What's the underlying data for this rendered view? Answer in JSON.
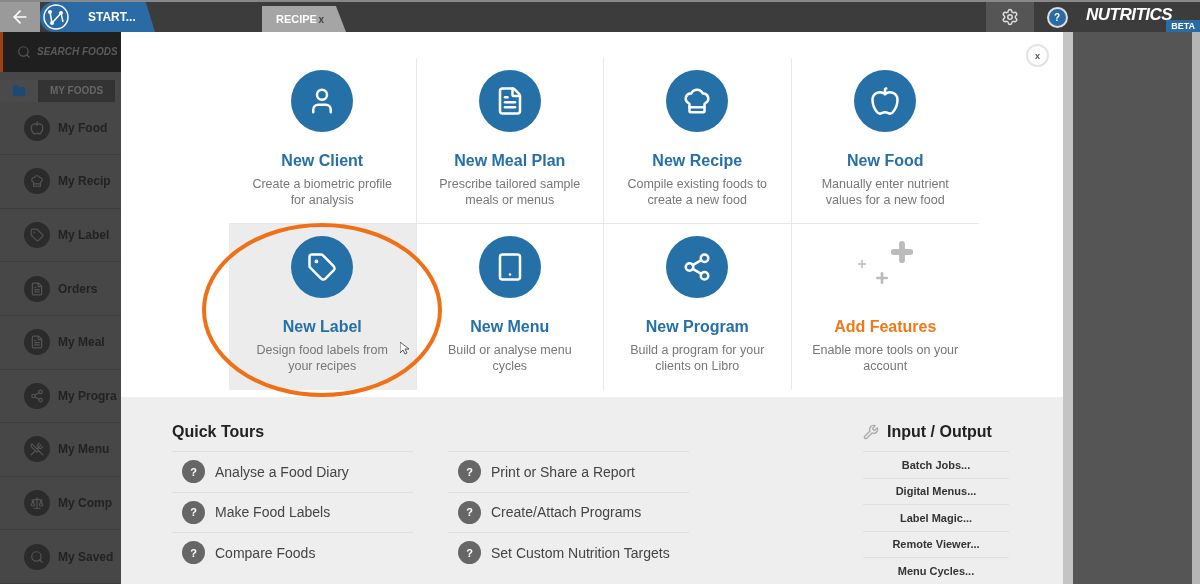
{
  "top_bar": {
    "home_tab": "START...",
    "tabs": [
      {
        "label": "RECIPE",
        "close": "x",
        "selected": true
      }
    ],
    "help": "?",
    "logo": "NUTRITICS",
    "logo_badge": "BETA"
  },
  "sidebar": {
    "search": {
      "placeholder": "SEARCH FOODS"
    },
    "tabs": [
      {
        "kind": "folder",
        "selected": true
      },
      {
        "kind": "text",
        "label": "MY FOODS",
        "selected": false
      }
    ],
    "items": [
      {
        "label": "My Food"
      },
      {
        "label": "My Recip"
      },
      {
        "label": "My Label"
      },
      {
        "label": "Orders"
      },
      {
        "label": "My Meal"
      },
      {
        "label": "My Progra"
      },
      {
        "label": "My Menu"
      },
      {
        "label": "My Comp"
      },
      {
        "label": "My Saved"
      }
    ]
  },
  "dialog": {
    "close": "x",
    "tiles": [
      {
        "kind": "action",
        "title": "New Client",
        "description": "Create a biometric profile for analysis",
        "selected": false
      },
      {
        "kind": "action",
        "title": "New Meal Plan",
        "description": "Prescribe tailored sample meals or menus",
        "selected": false
      },
      {
        "kind": "action",
        "title": "New Recipe",
        "description": "Compile existing foods to create a new food",
        "selected": false
      },
      {
        "kind": "action",
        "title": "New Food",
        "description": "Manually enter nutrient values for a new food",
        "selected": false
      },
      {
        "kind": "action",
        "title": "New Label",
        "description": "Design food labels from your recipes",
        "selected": true
      },
      {
        "kind": "action",
        "title": "New Menu",
        "description": "Build or analyse menu cycles",
        "selected": false
      },
      {
        "kind": "action",
        "title": "New Program",
        "description": "Build a program for your clients on Libro",
        "selected": false
      },
      {
        "kind": "addon",
        "title": "Add Features",
        "description": "Enable more tools on your account",
        "selected": false
      }
    ],
    "quick_tours": {
      "title": "Quick Tours",
      "columns": [
        [
          {
            "icon": "?",
            "label": "Analyse a Food Diary"
          },
          {
            "icon": "?",
            "label": "Make Food Labels"
          },
          {
            "icon": "?",
            "label": "Compare Foods"
          }
        ],
        [
          {
            "icon": "?",
            "label": "Print or Share a Report"
          },
          {
            "icon": "?",
            "label": "Create/Attach Programs"
          },
          {
            "icon": "?",
            "label": "Set Custom Nutrition Targets"
          }
        ]
      ]
    },
    "input_output": {
      "title": "Input / Output",
      "items": [
        "Batch Jobs...",
        "Digital Menus...",
        "Label Magic...",
        "Remote Viewer...",
        "Menu Cycles..."
      ]
    }
  }
}
